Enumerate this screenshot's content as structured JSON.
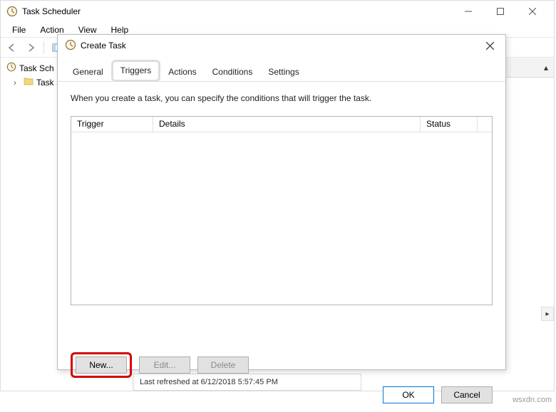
{
  "main_window": {
    "title": "Task Scheduler",
    "menu": {
      "file": "File",
      "action": "Action",
      "view": "View",
      "help": "Help"
    },
    "tree": {
      "root": "Task Sch",
      "child": "Task S"
    }
  },
  "status": {
    "text": "Last refreshed at 6/12/2018 5:57:45 PM"
  },
  "dialog": {
    "title": "Create Task",
    "tabs": {
      "general": "General",
      "triggers": "Triggers",
      "actions": "Actions",
      "conditions": "Conditions",
      "settings": "Settings"
    },
    "hint": "When you create a task, you can specify the conditions that will trigger the task.",
    "columns": {
      "trigger": "Trigger",
      "details": "Details",
      "status": "Status"
    },
    "buttons": {
      "new": "New...",
      "edit": "Edit...",
      "delete": "Delete",
      "ok": "OK",
      "cancel": "Cancel"
    }
  },
  "watermark": "wsxdn.com"
}
